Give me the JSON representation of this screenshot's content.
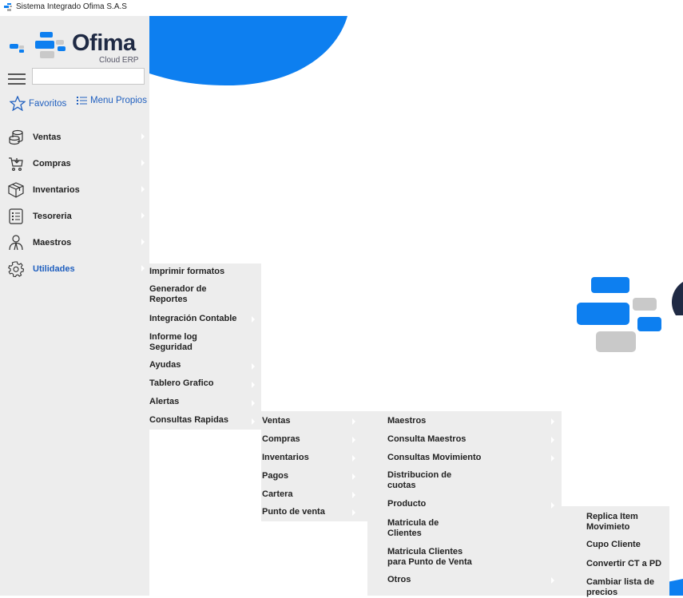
{
  "window": {
    "title": "Sistema Integrado Ofima S.A.S"
  },
  "logo": {
    "word": "Ofima",
    "sub": "Cloud ERP"
  },
  "search": {
    "value": "",
    "placeholder": ""
  },
  "favorites": {
    "favoritos_label": "Favoritos",
    "menu_propios_label": "Menu Propios"
  },
  "sidebar": {
    "items": [
      {
        "label": "Ventas",
        "icon": "coins-icon"
      },
      {
        "label": "Compras",
        "icon": "cart-icon"
      },
      {
        "label": "Inventarios",
        "icon": "box-icon"
      },
      {
        "label": "Tesoreria",
        "icon": "list-box-icon"
      },
      {
        "label": "Maestros",
        "icon": "person-icon"
      },
      {
        "label": "Utilidades",
        "icon": "gear-icon",
        "active": true
      }
    ]
  },
  "menu_utilidades": {
    "items": [
      {
        "label": "Imprimir formatos"
      },
      {
        "label": "Generador de Reportes"
      },
      {
        "label": "Integración Contable"
      },
      {
        "label": "Informe log Seguridad"
      },
      {
        "label": "Ayudas"
      },
      {
        "label": "Tablero Grafico"
      },
      {
        "label": "Alertas"
      },
      {
        "label": "Consultas Rapidas"
      }
    ]
  },
  "menu_consultas": {
    "items": [
      {
        "label": "Ventas"
      },
      {
        "label": "Compras"
      },
      {
        "label": "Inventarios"
      },
      {
        "label": "Pagos"
      },
      {
        "label": "Cartera"
      },
      {
        "label": "Punto de venta"
      }
    ]
  },
  "menu_punto_venta": {
    "items": [
      {
        "label": "Maestros"
      },
      {
        "label": "Consulta Maestros"
      },
      {
        "label": "Consultas Movimiento"
      },
      {
        "label": "Distribucion de cuotas"
      },
      {
        "label": "Producto"
      },
      {
        "label": "Matricula de Clientes"
      },
      {
        "label": "Matricula Clientes para Punto de Venta"
      },
      {
        "label": "Otros"
      }
    ]
  },
  "menu_producto": {
    "items": [
      {
        "label": "Replica Item Movimieto"
      },
      {
        "label": "Cupo Cliente"
      },
      {
        "label": "Convertir CT a PD"
      },
      {
        "label": "Cambiar lista de precios"
      }
    ]
  },
  "colors": {
    "accent": "#1f5fbf",
    "brand_blue": "#0d7ff0",
    "sidebar_bg": "#ededed",
    "brand_gray": "#c9c9c9",
    "logo_text": "#1f2a44"
  }
}
